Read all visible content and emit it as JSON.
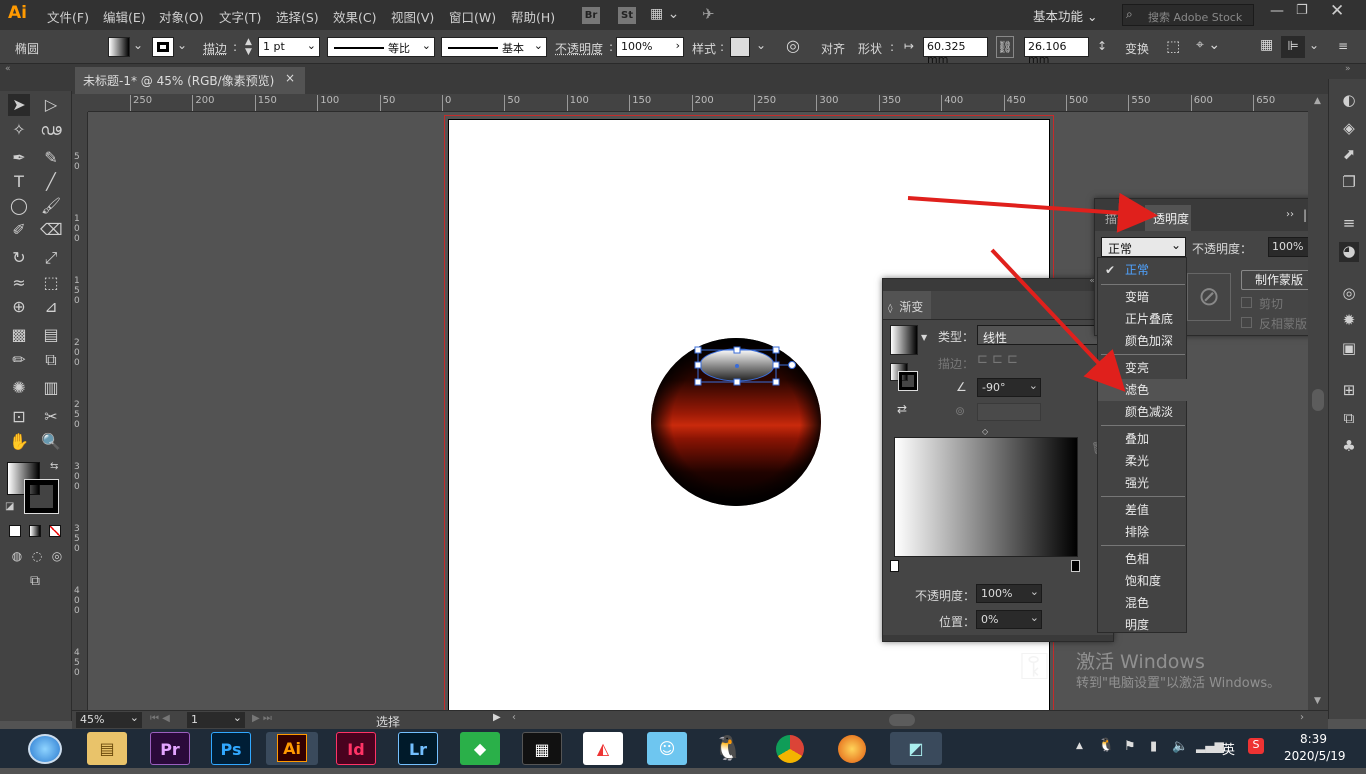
{
  "app": {
    "logo": "Ai"
  },
  "menu": [
    "文件(F)",
    "编辑(E)",
    "对象(O)",
    "文字(T)",
    "选择(S)",
    "效果(C)",
    "视图(V)",
    "窗口(W)",
    "帮助(H)"
  ],
  "bridge": {
    "br": "Br",
    "st": "St"
  },
  "workspace": "基本功能",
  "search_placeholder": "搜索 Adobe Stock",
  "control": {
    "object_type": "椭圆",
    "stroke_label": "描边",
    "stroke_value": "1 pt",
    "profile1": "等比",
    "profile2": "基本",
    "opacity_label": "不透明度",
    "opacity_value": "100%",
    "style_label": "样式",
    "align_label": "对齐",
    "shape_label": "形状",
    "width_value": "60.325 mm",
    "height_value": "26.106 mm",
    "transform_label": "变换"
  },
  "document_tab": {
    "title": "未标题-1* @ 45% (RGB/像素预览)",
    "close": "×"
  },
  "ruler_h": [
    "250",
    "200",
    "150",
    "100",
    "50",
    "0",
    "50",
    "100",
    "150",
    "200",
    "250",
    "300",
    "350",
    "400",
    "450",
    "500",
    "550",
    "600",
    "650"
  ],
  "ruler_v": [
    "5\n0",
    "1\n0\n0",
    "1\n5\n0",
    "2\n0\n0",
    "2\n5\n0",
    "3\n0\n0",
    "3\n5\n0",
    "4\n0\n0",
    "4\n5\n0",
    "5\n0\n0"
  ],
  "gradient_panel": {
    "title": "渐变",
    "type_label": "类型：",
    "type_value": "线性",
    "stroke_label": "描边：",
    "angle_value": "-90°",
    "opacity_label": "不透明度：",
    "opacity_value": "100%",
    "location_label": "位置：",
    "location_value": "0%",
    "colors": {
      "start": "#ffffff",
      "end": "#000000"
    }
  },
  "transparency_panel": {
    "tab_stroke": "描边",
    "tab_active": "透明度",
    "blend_mode": "正常",
    "opacity_label": "不透明度：",
    "opacity_value": "100%",
    "make_mask": "制作蒙版",
    "clip": "剪切",
    "invert_mask": "反相蒙版"
  },
  "blend_modes": {
    "group1": [
      "正常"
    ],
    "group2": [
      "变暗",
      "正片叠底",
      "颜色加深"
    ],
    "group3": [
      "变亮",
      "滤色",
      "颜色减淡"
    ],
    "group4": [
      "叠加",
      "柔光",
      "强光"
    ],
    "group5": [
      "差值",
      "排除"
    ],
    "group6": [
      "色相",
      "饱和度",
      "混色",
      "明度"
    ],
    "selected": "正常",
    "highlighted": "滤色"
  },
  "status": {
    "zoom": "45%",
    "artboard": "1",
    "tool": "选择"
  },
  "watermark": {
    "line1": "激活 Windows",
    "line2": "转到\"电脑设置\"以激活 Windows。"
  },
  "taskbar": {
    "apps": [
      "Pr",
      "Ps",
      "Ai",
      "Id",
      "Lr"
    ],
    "time": "8:39",
    "date": "2020/5/19",
    "ime": "英"
  },
  "colors": {
    "accent_red": "#e0201c",
    "sphere_red": "#c0200a",
    "selection": "#3a6cd8"
  }
}
